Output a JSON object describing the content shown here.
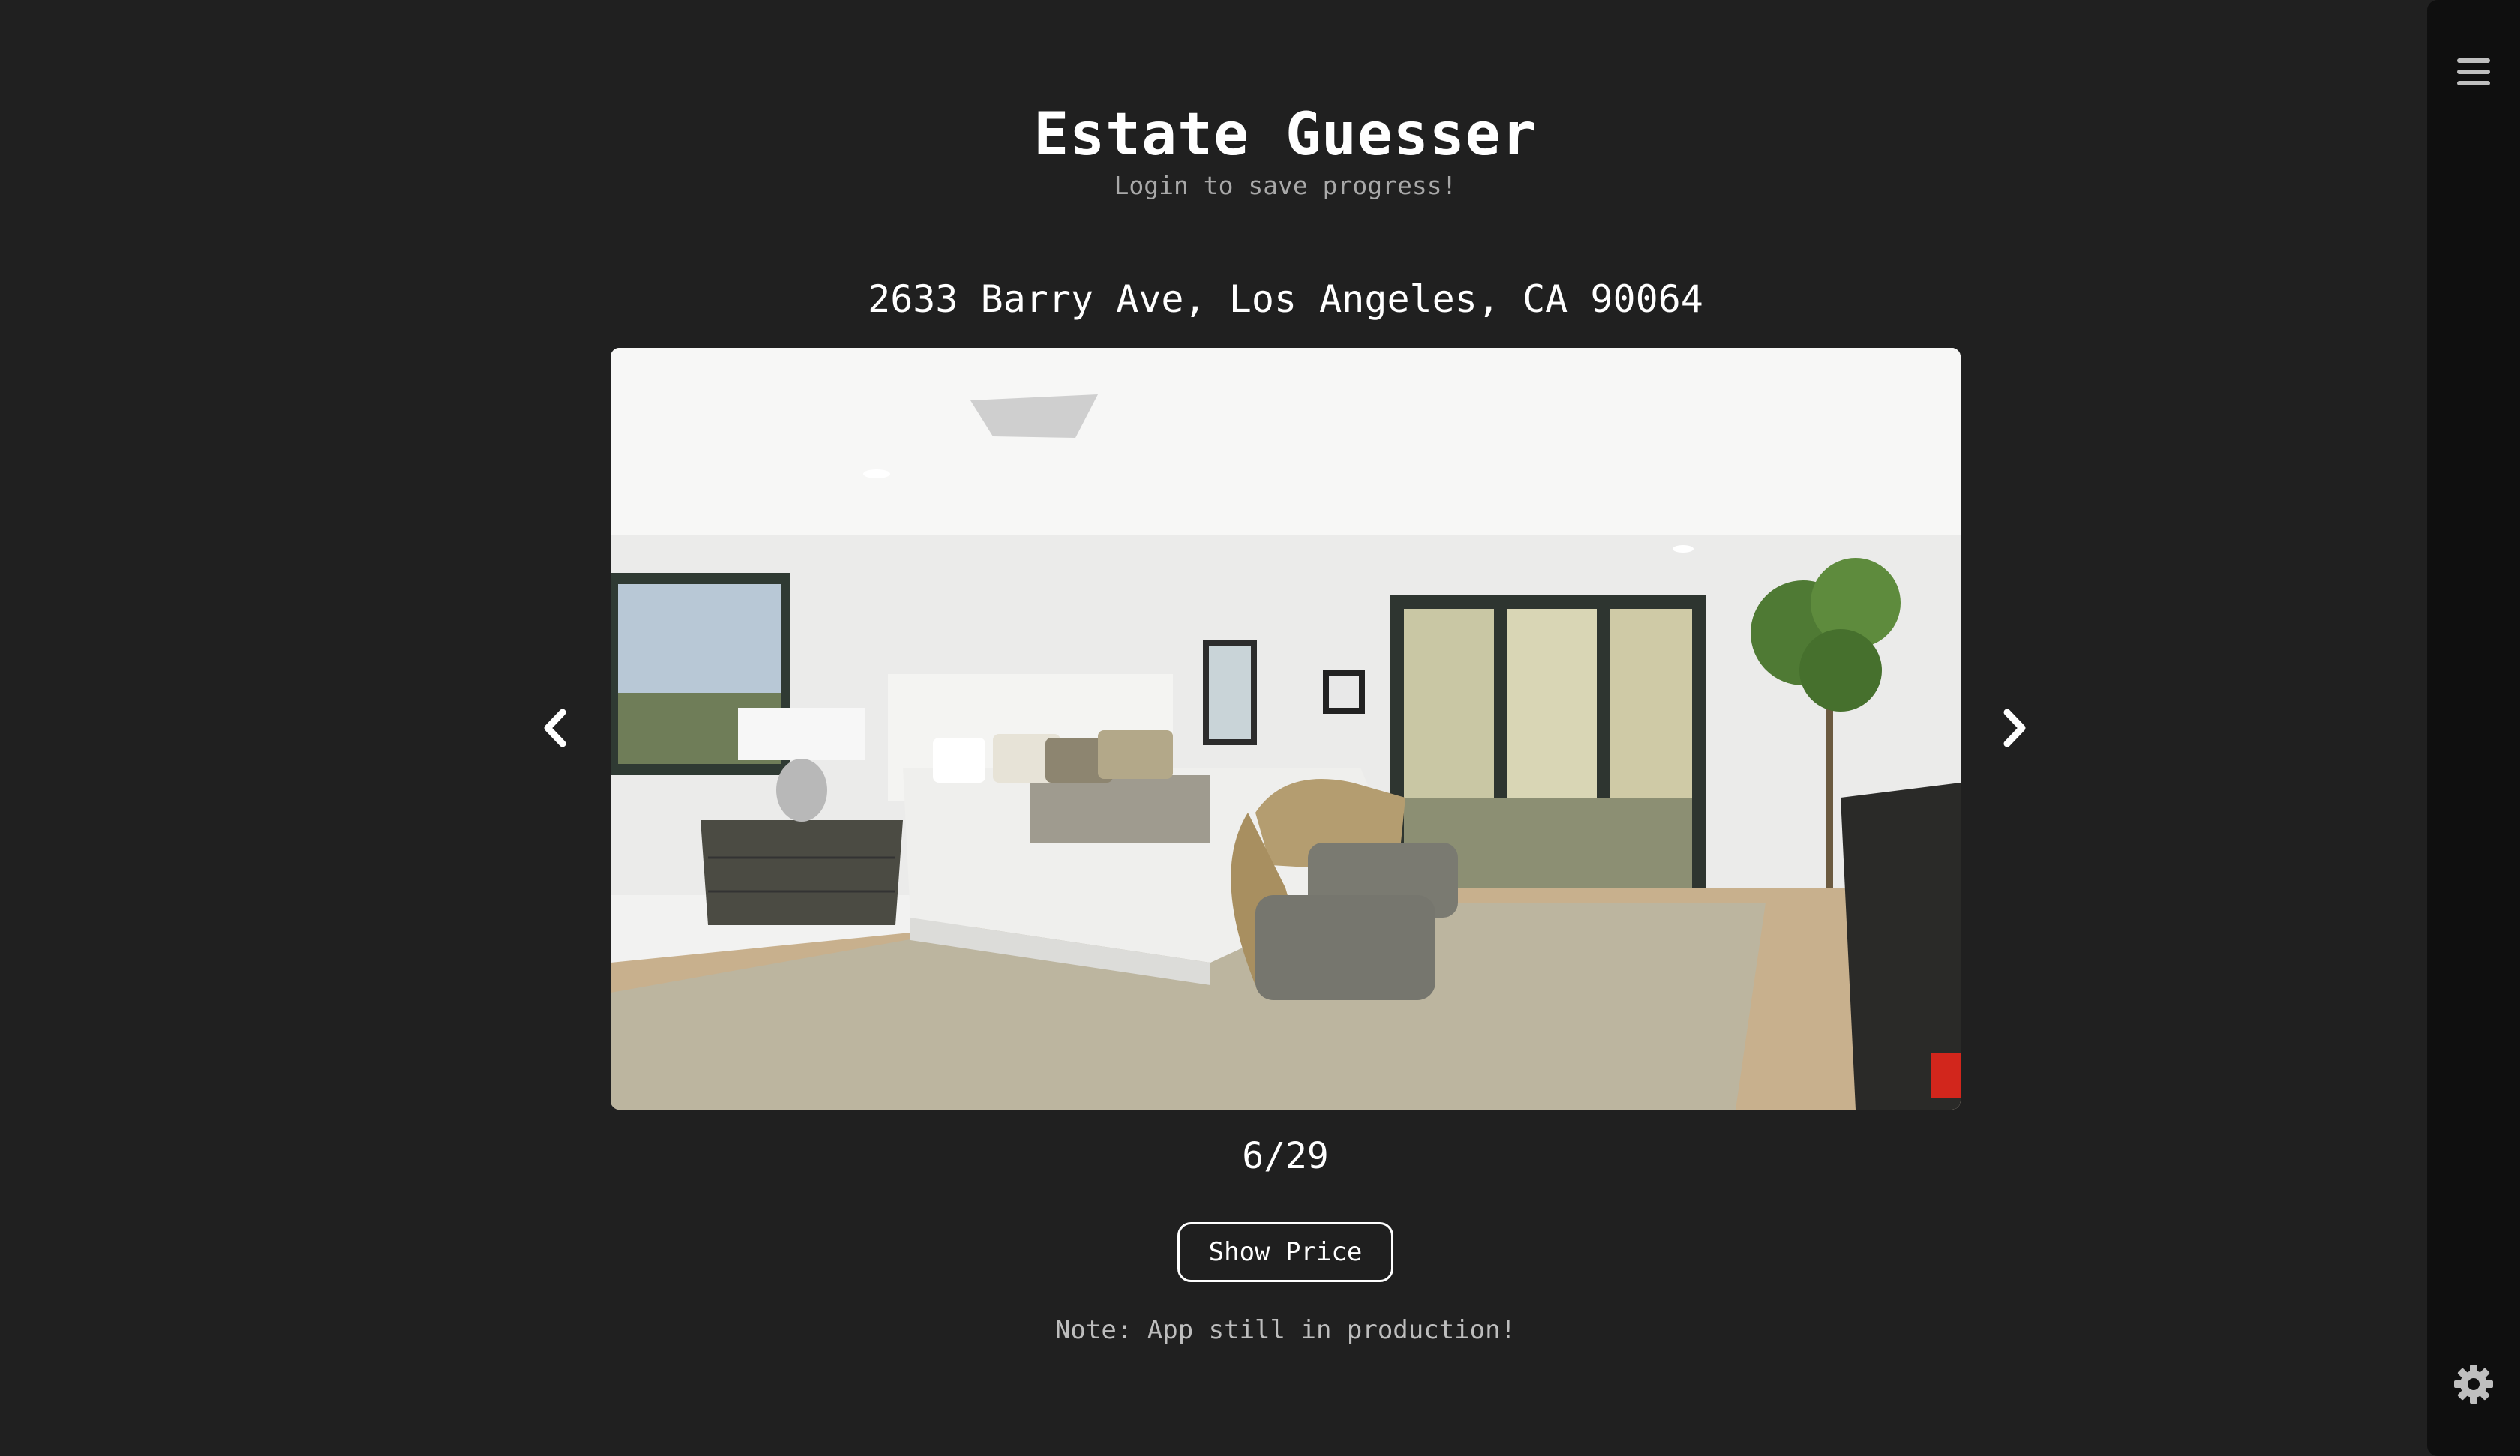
{
  "app": {
    "title": "Estate Guesser",
    "subtitle": "Login to save progress!"
  },
  "listing": {
    "address": "2633 Barry Ave, Los Angeles, CA 90064",
    "photo_index": 6,
    "photo_total": 29,
    "counter_text": "6/29"
  },
  "actions": {
    "show_price_label": "Show Price"
  },
  "footer": {
    "note": "Note: App still in production!"
  },
  "icons": {
    "prev": "chevron-left-icon",
    "next": "chevron-right-icon",
    "menu": "hamburger-menu-icon",
    "settings": "gear-icon"
  },
  "colors": {
    "background": "#202020",
    "sidebar": "#0f0f0f",
    "text": "#ffffff",
    "muted_text": "#a9a9a9"
  }
}
